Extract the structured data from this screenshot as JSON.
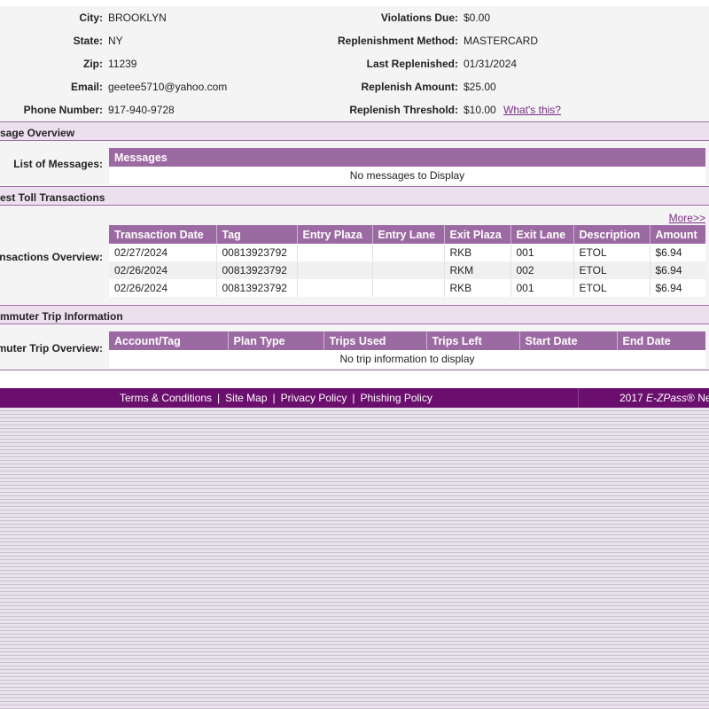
{
  "account_info": {
    "left": [
      {
        "label": "City:",
        "value": "BROOKLYN"
      },
      {
        "label": "State:",
        "value": "NY"
      },
      {
        "label": "Zip:",
        "value": "11239"
      },
      {
        "label": "Email:",
        "value": "geetee5710@yahoo.com"
      },
      {
        "label": "Phone Number:",
        "value": "917-940-9728"
      }
    ],
    "right": [
      {
        "label": "Violations Due:",
        "value": "$0.00"
      },
      {
        "label": "Replenishment Method:",
        "value": "MASTERCARD"
      },
      {
        "label": "Last Replenished:",
        "value": "01/31/2024"
      },
      {
        "label": "Replenish Amount:",
        "value": "$25.00"
      },
      {
        "label": "Replenish Threshold:",
        "value": "$10.00"
      }
    ],
    "whats_this": "What's this?"
  },
  "messages": {
    "section_title": "sage Overview",
    "side_label": "List of Messages:",
    "header": "Messages",
    "empty_text": "No messages to Display"
  },
  "transactions": {
    "section_title": "est Toll Transactions",
    "more_link": "More>>",
    "side_label": "ransactions Overview:",
    "columns": [
      "Transaction Date",
      "Tag",
      "Entry Plaza",
      "Entry Lane",
      "Exit Plaza",
      "Exit Lane",
      "Description",
      "Amount"
    ],
    "rows": [
      [
        "02/27/2024",
        "00813923792",
        "",
        "",
        "RKB",
        "001",
        "ETOL",
        "$6.94"
      ],
      [
        "02/26/2024",
        "00813923792",
        "",
        "",
        "RKM",
        "002",
        "ETOL",
        "$6.94"
      ],
      [
        "02/26/2024",
        "00813923792",
        "",
        "",
        "RKB",
        "001",
        "ETOL",
        "$6.94"
      ]
    ]
  },
  "commuter": {
    "section_title": "mmuter Trip Information",
    "side_label": "mmuter Trip Overview:",
    "columns": [
      "Account/Tag",
      "Plan Type",
      "Trips Used",
      "Trips Left",
      "Start Date",
      "End Date"
    ],
    "empty_text": "No trip information to display"
  },
  "footer": {
    "links": [
      "Terms & Conditions",
      "Site Map",
      "Privacy Policy",
      "Phishing Policy"
    ],
    "copyright_prefix": "2017 ",
    "copyright_brand": "E-ZPass",
    "copyright_suffix": "® New"
  },
  "colors": {
    "header_purple": "#9c6aa2",
    "section_bg": "#ece0ee",
    "footer_purple": "#6b0f6e",
    "link_purple": "#7a2c86"
  }
}
